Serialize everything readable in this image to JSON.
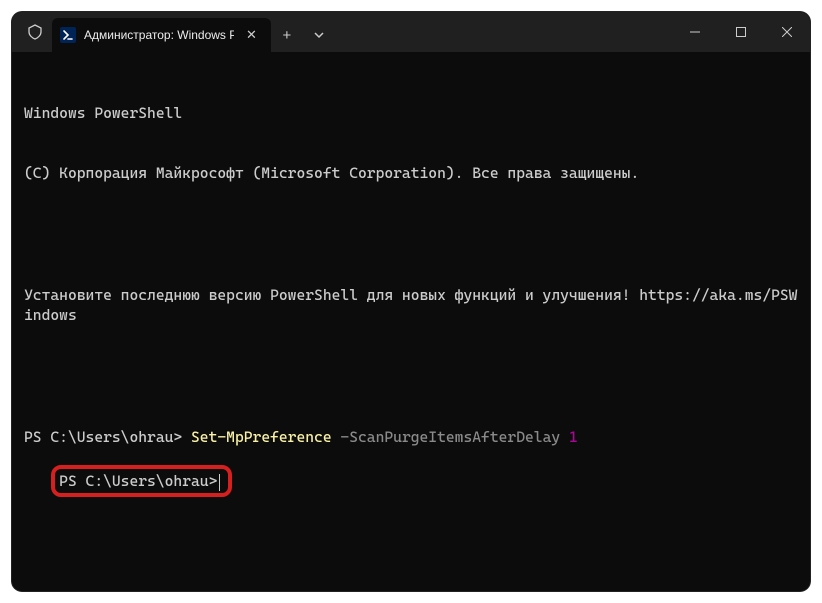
{
  "titlebar": {
    "tab_title": "Администратор: Windows Po",
    "close_glyph": "✕",
    "new_tab_glyph": "+",
    "dropdown_glyph": "⌄"
  },
  "terminal": {
    "line1": "Windows PowerShell",
    "line2": "(C) Корпорация Майкрософт (Microsoft Corporation). Все права защищены.",
    "line3": "Установите последнюю версию PowerShell для новых функций и улучшения! https://aka.ms/PSWindows",
    "prompt1": "PS C:\\Users\\ohrau> ",
    "cmd_name": "Set-MpPreference",
    "cmd_param": " -ScanPurgeItemsAfterDelay ",
    "cmd_value": "1",
    "prompt2": "PS C:\\Users\\ohrau>"
  }
}
